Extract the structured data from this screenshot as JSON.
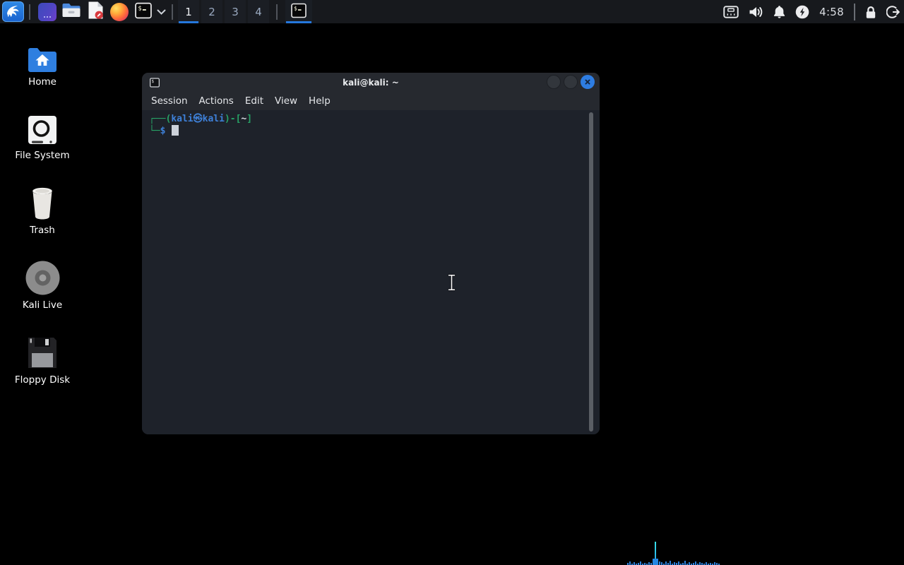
{
  "colors": {
    "panel_bg": "#17191d",
    "accent_blue": "#2577dc",
    "close_blue": "#2e7de2",
    "prompt_green": "#27a366",
    "prompt_blue": "#3e80d8",
    "graph_blue": "#2b7fd9",
    "window_chrome": "#26292f",
    "terminal_bg": "#1e222a"
  },
  "panel": {
    "menu_button_icon": "kali-dragon-icon",
    "launchers": [
      {
        "name": "terminal-emulator"
      },
      {
        "name": "file-manager"
      },
      {
        "name": "text-editor"
      },
      {
        "name": "firefox-browser"
      },
      {
        "name": "qterminal-dropdown"
      }
    ],
    "workspaces": {
      "items": [
        "1",
        "2",
        "3",
        "4"
      ],
      "active_index": 0
    },
    "taskbar_window_icon": "qterminal-icon",
    "graph": {
      "bars": [
        3,
        5,
        2,
        4,
        2,
        3,
        5,
        2,
        3,
        2,
        4,
        3,
        2,
        33,
        3,
        5,
        4,
        2,
        5,
        3,
        6,
        2,
        4,
        3,
        5,
        2,
        3,
        6,
        2,
        4,
        2,
        3,
        5,
        2,
        4,
        3,
        2,
        4,
        2,
        3,
        2,
        4,
        3,
        2
      ]
    },
    "tray_icons": [
      "network-icon",
      "volume-icon",
      "notifications-bell-icon",
      "power-manager-icon",
      "lock-screen-icon",
      "logout-icon"
    ],
    "clock": "4:58"
  },
  "desktop": {
    "icons": [
      {
        "label": "Home",
        "icon": "home-folder-icon"
      },
      {
        "label": "File System",
        "icon": "drive-icon"
      },
      {
        "label": "Trash",
        "icon": "trash-can-icon"
      },
      {
        "label": "Kali Live",
        "icon": "disc-icon"
      },
      {
        "label": "Floppy Disk",
        "icon": "floppy-disk-icon"
      }
    ]
  },
  "terminal": {
    "title": "kali@kali: ~",
    "menu": [
      "Session",
      "Actions",
      "Edit",
      "View",
      "Help"
    ],
    "prompt": {
      "frame_top": "┌──(",
      "user": "kali㉿kali",
      "separator": ")-[",
      "path": "~",
      "bracket_close": "]",
      "frame_bottom": "└─",
      "prompt_char": "$"
    }
  }
}
